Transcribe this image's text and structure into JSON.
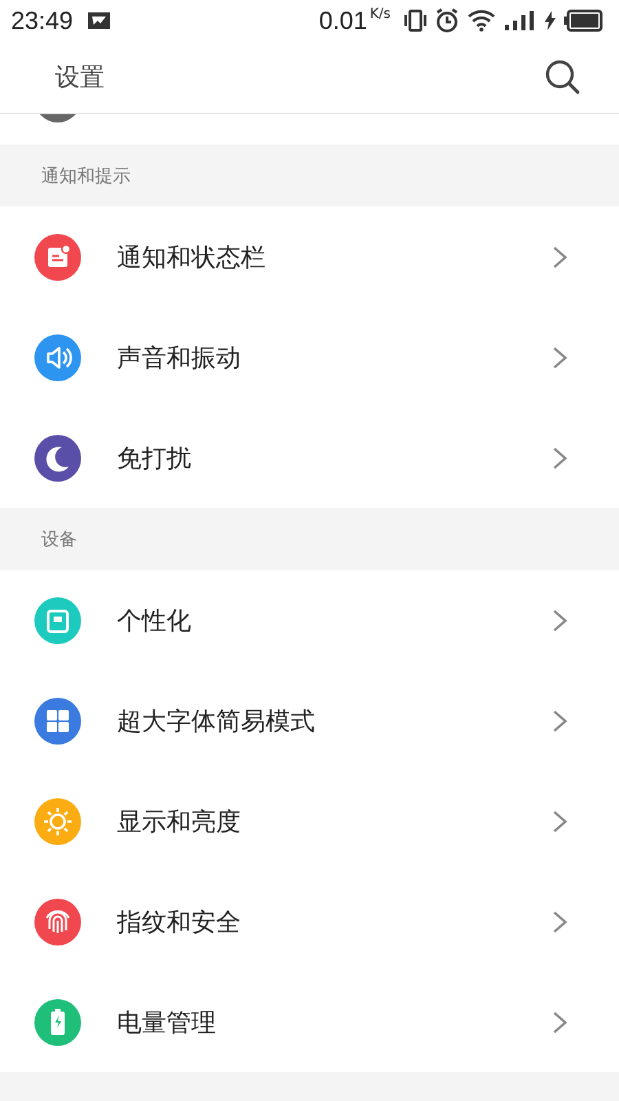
{
  "status_bar": {
    "time": "23:49",
    "speed": "0.01",
    "speed_unit": "K/s"
  },
  "header": {
    "title": "设置"
  },
  "sections": [
    {
      "title": "通知和提示",
      "items": [
        {
          "label": "通知和状态栏",
          "kind": "notification",
          "color": "#f0484e"
        },
        {
          "label": "声音和振动",
          "kind": "sound",
          "color": "#2d95f0"
        },
        {
          "label": "免打扰",
          "kind": "moon",
          "color": "#5a4fa8"
        }
      ]
    },
    {
      "title": "设备",
      "items": [
        {
          "label": "个性化",
          "kind": "theme",
          "color": "#1ccbbd"
        },
        {
          "label": "超大字体简易模式",
          "kind": "grid",
          "color": "#3b7be0"
        },
        {
          "label": "显示和亮度",
          "kind": "sun",
          "color": "#fbac12"
        },
        {
          "label": "指纹和安全",
          "kind": "fingerprint",
          "color": "#f0484e"
        },
        {
          "label": "电量管理",
          "kind": "battery",
          "color": "#1fbf7a"
        }
      ]
    }
  ]
}
